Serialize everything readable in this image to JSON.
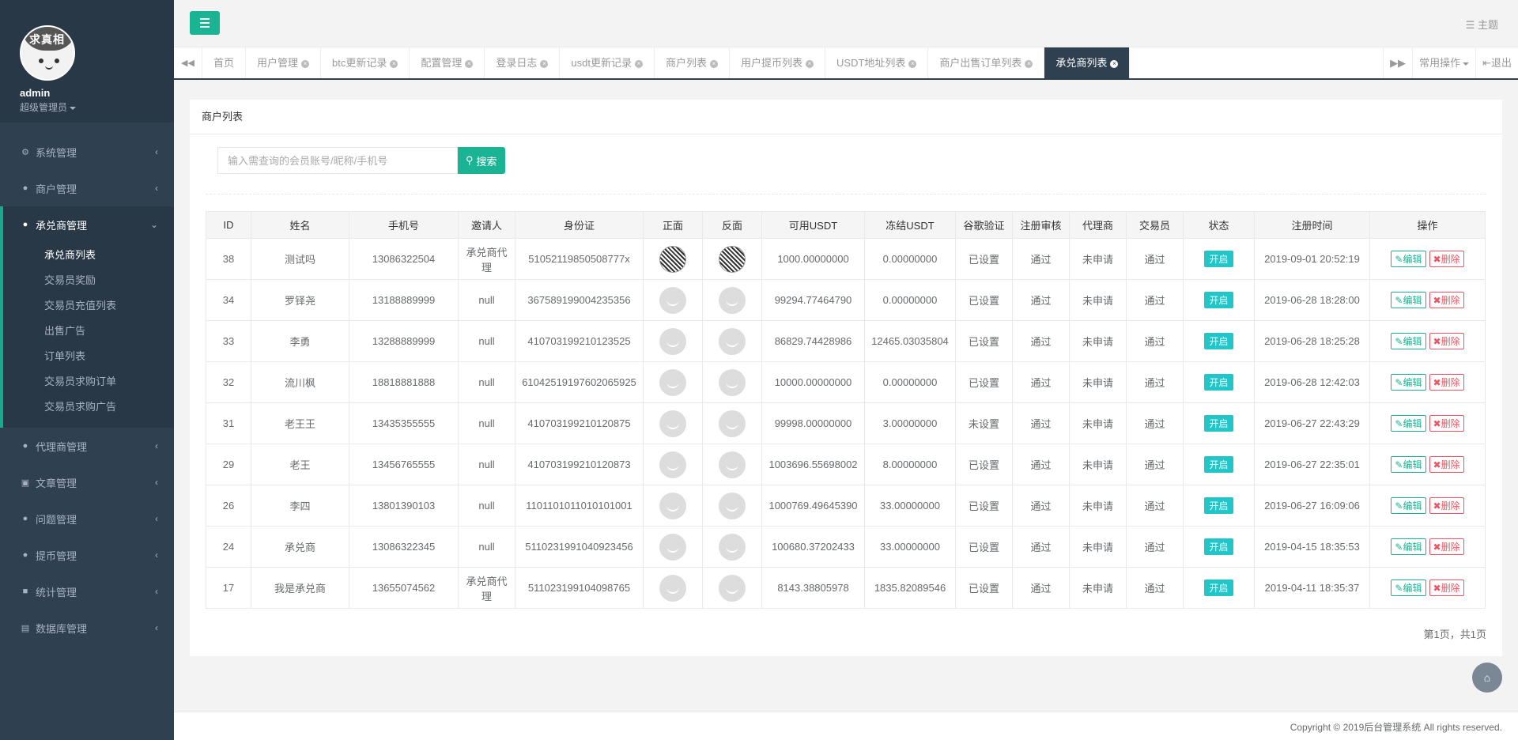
{
  "sidebar": {
    "avatar_text": "求真相",
    "username": "admin",
    "role": "超级管理员",
    "menu": [
      {
        "icon": "gear",
        "label": "系统管理"
      },
      {
        "icon": "user",
        "label": "商户管理"
      }
    ],
    "active_group": {
      "icon": "user",
      "label": "承兑商管理",
      "items": [
        "承兑商列表",
        "交易员奖励",
        "交易员充值列表",
        "出售广告",
        "订单列表",
        "交易员求购订单",
        "交易员求购广告"
      ]
    },
    "menu_after": [
      {
        "icon": "user",
        "label": "代理商管理"
      },
      {
        "icon": "copy",
        "label": "文章管理"
      },
      {
        "icon": "comment",
        "label": "问题管理"
      },
      {
        "icon": "user",
        "label": "提币管理"
      },
      {
        "icon": "cube",
        "label": "统计管理"
      },
      {
        "icon": "database",
        "label": "数据库管理"
      }
    ]
  },
  "header": {
    "theme_label": "主题"
  },
  "tabs": {
    "items": [
      "首页",
      "用户管理",
      "btc更新记录",
      "配置管理",
      "登录日志",
      "usdt更新记录",
      "商户列表",
      "用户提币列表",
      "USDT地址列表",
      "商户出售订单列表",
      "承兑商列表"
    ],
    "active_index": 10,
    "common_ops": "常用操作",
    "logout": "退出"
  },
  "panel": {
    "title": "商户列表",
    "search_placeholder": "输入需查询的会员账号/昵称/手机号",
    "search_button": "搜索"
  },
  "table": {
    "headers": [
      "ID",
      "姓名",
      "手机号",
      "邀请人",
      "身份证",
      "正面",
      "反面",
      "可用USDT",
      "冻结USDT",
      "谷歌验证",
      "注册审核",
      "代理商",
      "交易员",
      "状态",
      "注册时间",
      "操作"
    ],
    "rows": [
      {
        "id": "38",
        "name": "测试吗",
        "phone": "13086322504",
        "inviter": "承兑商代理",
        "idcard": "51052119850508777x",
        "img": "qr",
        "usdt": "1000.00000000",
        "frozen": "0.00000000",
        "google": "已设置",
        "review": "通过",
        "agent": "未申请",
        "trader": "通过",
        "status": "开启",
        "time": "2019-09-01 20:52:19"
      },
      {
        "id": "34",
        "name": "罗铎尧",
        "phone": "13188889999",
        "inviter": "null",
        "idcard": "367589199004235356",
        "img": "face",
        "usdt": "99294.77464790",
        "frozen": "0.00000000",
        "google": "已设置",
        "review": "通过",
        "agent": "未申请",
        "trader": "通过",
        "status": "开启",
        "time": "2019-06-28 18:28:00"
      },
      {
        "id": "33",
        "name": "李勇",
        "phone": "13288889999",
        "inviter": "null",
        "idcard": "410703199210123525",
        "img": "face",
        "usdt": "86829.74428986",
        "frozen": "12465.03035804",
        "google": "已设置",
        "review": "通过",
        "agent": "未申请",
        "trader": "通过",
        "status": "开启",
        "time": "2019-06-28 18:25:28"
      },
      {
        "id": "32",
        "name": "流川枫",
        "phone": "18818881888",
        "inviter": "null",
        "idcard": "61042519197602065925",
        "img": "face",
        "usdt": "10000.00000000",
        "frozen": "0.00000000",
        "google": "已设置",
        "review": "通过",
        "agent": "未申请",
        "trader": "通过",
        "status": "开启",
        "time": "2019-06-28 12:42:03"
      },
      {
        "id": "31",
        "name": "老王王",
        "phone": "13435355555",
        "inviter": "null",
        "idcard": "410703199210120875",
        "img": "face",
        "usdt": "99998.00000000",
        "frozen": "3.00000000",
        "google": "未设置",
        "review": "通过",
        "agent": "未申请",
        "trader": "通过",
        "status": "开启",
        "time": "2019-06-27 22:43:29"
      },
      {
        "id": "29",
        "name": "老王",
        "phone": "13456765555",
        "inviter": "null",
        "idcard": "410703199210120873",
        "img": "face",
        "usdt": "1003696.55698002",
        "frozen": "8.00000000",
        "google": "已设置",
        "review": "通过",
        "agent": "未申请",
        "trader": "通过",
        "status": "开启",
        "time": "2019-06-27 22:35:01"
      },
      {
        "id": "26",
        "name": "李四",
        "phone": "13801390103",
        "inviter": "null",
        "idcard": "1101101011010101001",
        "img": "face",
        "usdt": "1000769.49645390",
        "frozen": "33.00000000",
        "google": "已设置",
        "review": "通过",
        "agent": "未申请",
        "trader": "通过",
        "status": "开启",
        "time": "2019-06-27 16:09:06"
      },
      {
        "id": "24",
        "name": "承兑商",
        "phone": "13086322345",
        "inviter": "null",
        "idcard": "5110231991040923456",
        "img": "face",
        "usdt": "100680.37202433",
        "frozen": "33.00000000",
        "google": "已设置",
        "review": "通过",
        "agent": "未申请",
        "trader": "通过",
        "status": "开启",
        "time": "2019-04-15 18:35:53"
      },
      {
        "id": "17",
        "name": "我是承兑商",
        "phone": "13655074562",
        "inviter": "承兑商代理",
        "idcard": "511023199104098765",
        "img": "face",
        "usdt": "8143.38805978",
        "frozen": "1835.82089546",
        "google": "已设置",
        "review": "通过",
        "agent": "未申请",
        "trader": "通过",
        "status": "开启",
        "time": "2019-04-11 18:35:37"
      }
    ],
    "edit_label": "编辑",
    "delete_label": "删除"
  },
  "pager_text": "第1页，共1页",
  "footer_text": "Copyright © 2019后台管理系统 All rights reserved.",
  "colors": {
    "primary": "#1ab394",
    "sidebar": "#2f4050",
    "info": "#23c6c8",
    "danger": "#ed5565"
  }
}
